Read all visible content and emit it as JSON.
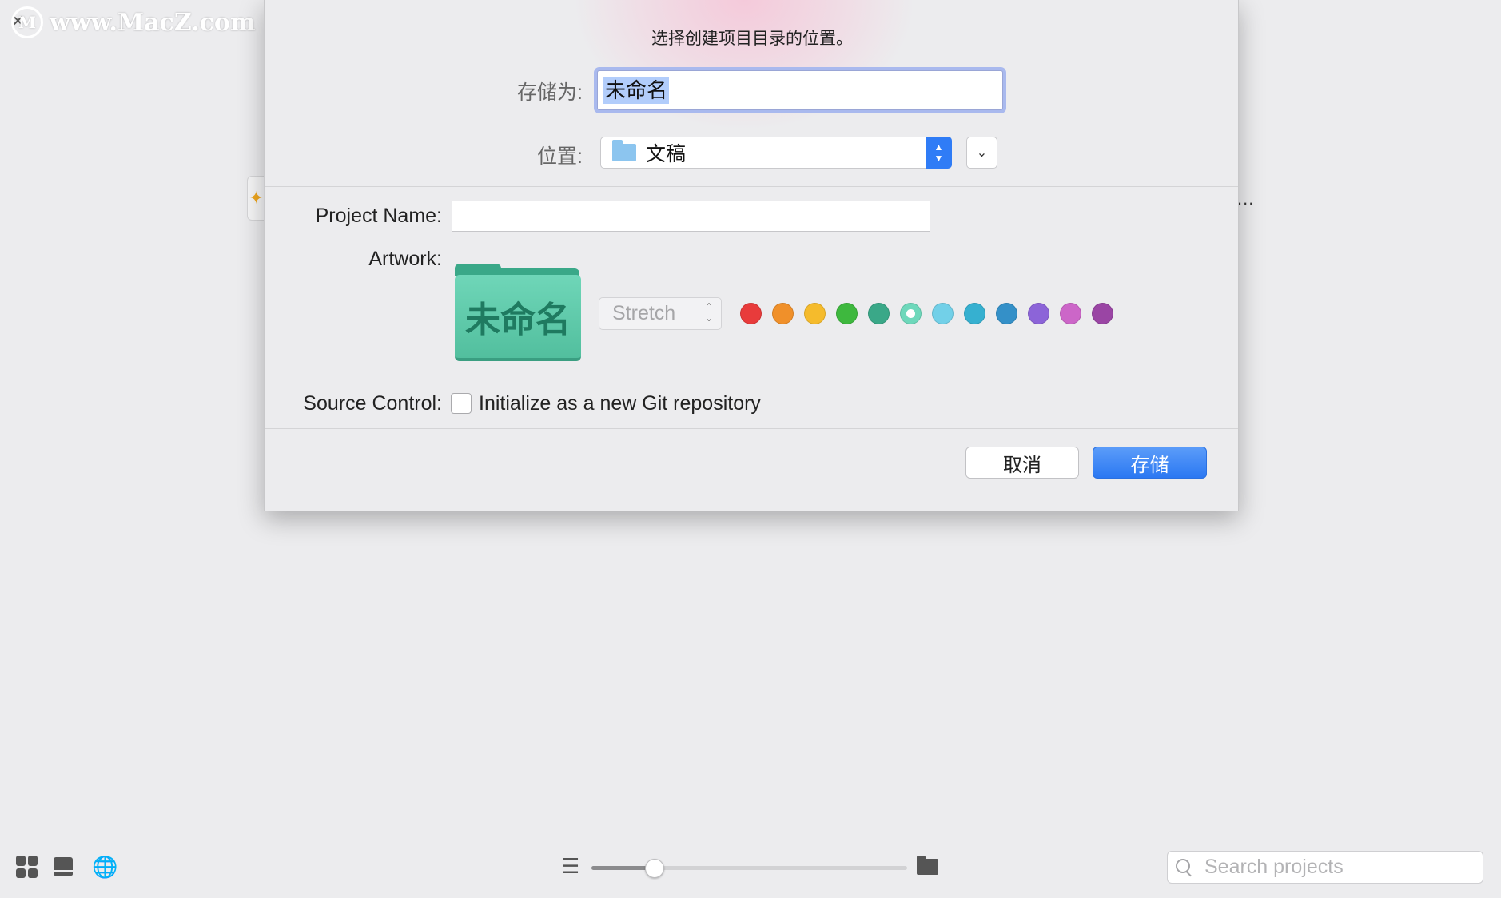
{
  "watermark": {
    "text": "www.MacZ.com",
    "logo": "M"
  },
  "background": {
    "close_glyph": "✕",
    "ellipsis": "..."
  },
  "dialog": {
    "message": "选择创建项目目录的位置。",
    "save_as": {
      "label": "存储为:",
      "value": "未命名"
    },
    "location": {
      "label": "位置:",
      "value": "文稿",
      "icon": "folder-icon"
    },
    "project_name": {
      "label": "Project Name:",
      "value": ""
    },
    "artwork": {
      "label": "Artwork:",
      "folder_text": "未命名",
      "fit_mode": "Stretch"
    },
    "colors": [
      "#e83b3b",
      "#f0902a",
      "#f5bb2c",
      "#3eb83e",
      "#3aa888",
      "#6ed8bb",
      "#72d0e8",
      "#36b0d0",
      "#3490c8",
      "#8c64d8",
      "#cc66c8",
      "#9a45a4"
    ],
    "selected_color_index": 5,
    "source_control": {
      "label": "Source Control:",
      "checkbox_label": "Initialize as a new Git repository",
      "checked": false
    },
    "buttons": {
      "cancel": "取消",
      "save": "存储"
    }
  },
  "toolbar": {
    "zoom": 0.2,
    "search_placeholder": "Search projects",
    "icons": [
      "grid-icon",
      "drive-icon",
      "globe-icon",
      "list-icon",
      "folder-icon"
    ]
  }
}
